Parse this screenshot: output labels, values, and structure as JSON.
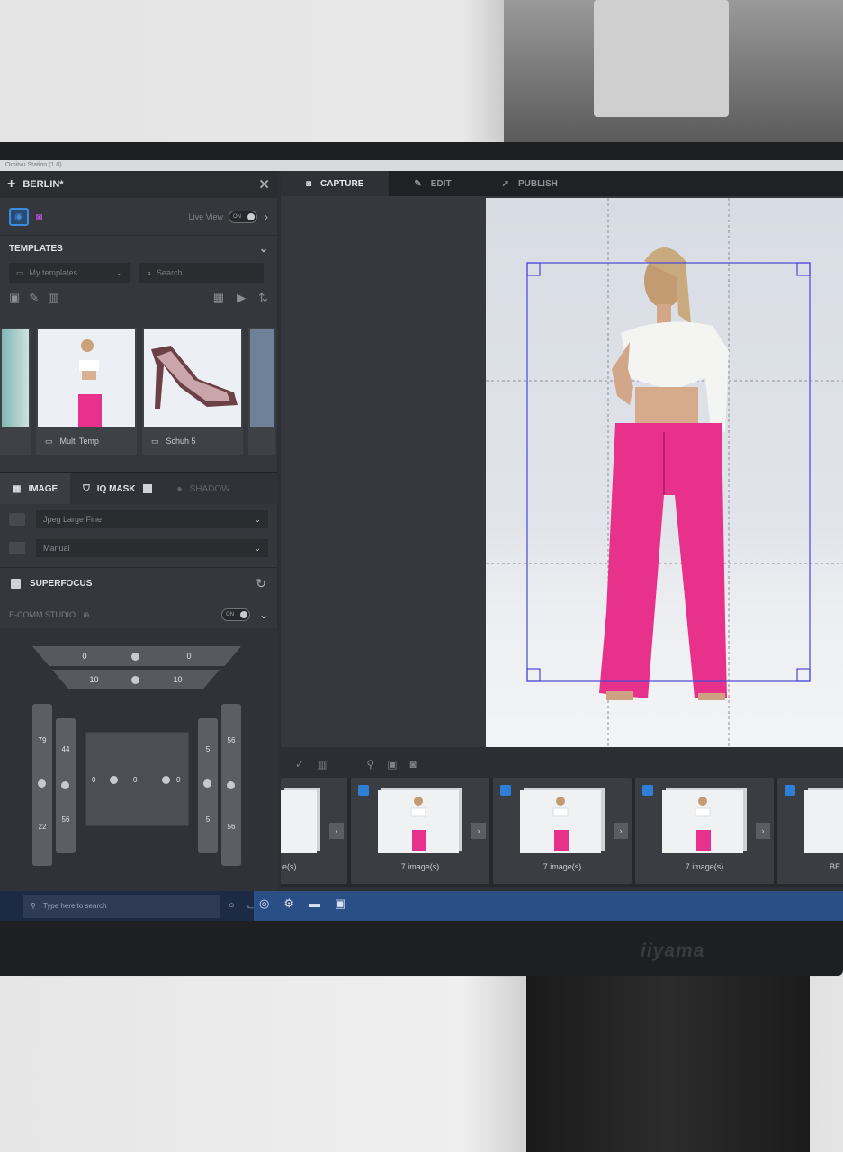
{
  "app": {
    "window_title": "Orbitvu Station (1.0)",
    "project": "BERLIN*",
    "close_glyph": "✕"
  },
  "capture_toolbar": {
    "live_view_label": "Live View",
    "live_view_toggle": "ON"
  },
  "templates": {
    "section_title": "TEMPLATES",
    "folder_select": "My templates",
    "search_placeholder": "Search...",
    "items": [
      {
        "label": "Multi Temp"
      },
      {
        "label": "Schuh 5"
      }
    ]
  },
  "settings_tabs": [
    {
      "label": "IMAGE"
    },
    {
      "label": "IQ MASK"
    },
    {
      "label": "SHADOW"
    }
  ],
  "image_settings": {
    "format": "Jpeg Large Fine",
    "mode": "Manual"
  },
  "superfocus": {
    "label": "SUPERFOCUS"
  },
  "ecomm_studio": {
    "label": "E-COMM STUDIO",
    "toggle": "ON",
    "top_lights": [
      "0",
      "0"
    ],
    "mid_lights": [
      "10",
      "10"
    ],
    "left_outer": [
      "79",
      "22"
    ],
    "left_inner": [
      "44",
      "56"
    ],
    "center_values": [
      "0",
      "0",
      "0",
      "0"
    ],
    "right_inner": [
      "5",
      "5"
    ],
    "right_outer": [
      "56",
      "56"
    ]
  },
  "main_tabs": [
    {
      "label": "CAPTURE"
    },
    {
      "label": "EDIT"
    },
    {
      "label": "PUBLISH"
    }
  ],
  "filmstrip": {
    "items": [
      {
        "label": "7 image(s)"
      },
      {
        "label": "7 image(s)"
      },
      {
        "label": "7 image(s)"
      },
      {
        "label": "7 image(s)"
      },
      {
        "label": "BE"
      }
    ],
    "first_partial_label": "e(s)"
  },
  "taskbar": {
    "search_placeholder": "Type here to search"
  },
  "monitor": {
    "brand": "iiyama"
  },
  "colors": {
    "accent_blue": "#3d8be0",
    "accent_purple": "#b04fd0",
    "pants_pink": "#e8318a",
    "frame_overlay": "#4b47d8"
  }
}
